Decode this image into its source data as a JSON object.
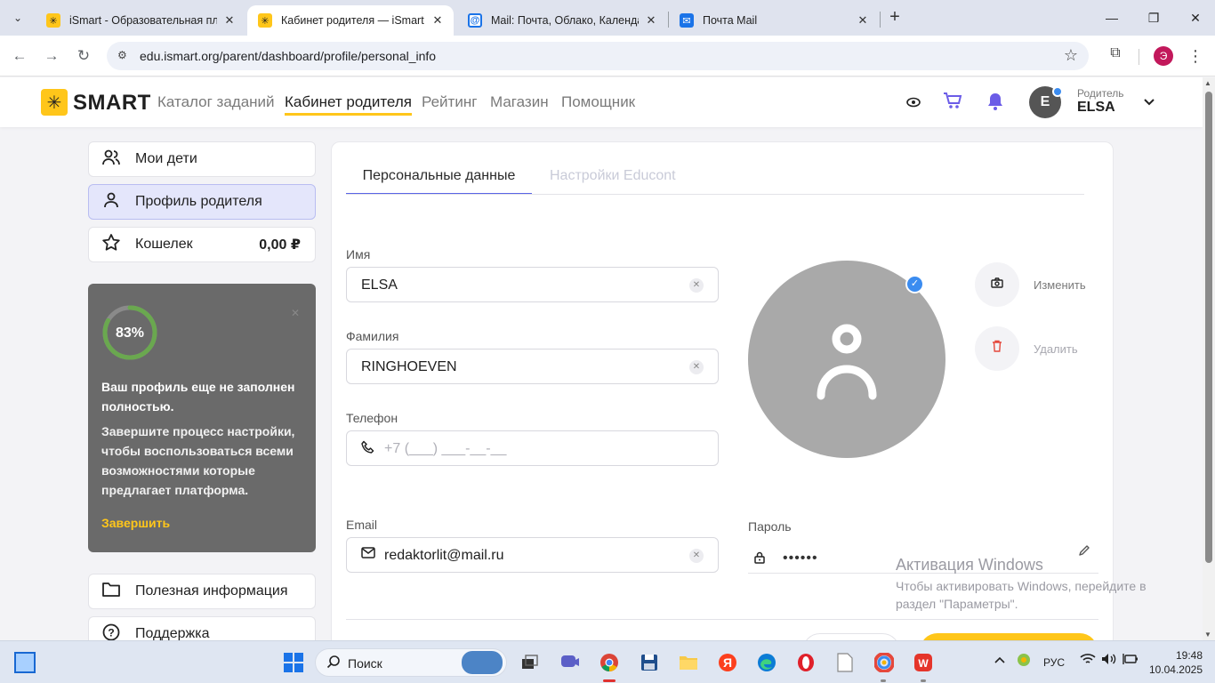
{
  "browser": {
    "tabs": [
      {
        "title": "iSmart - Образовательная пла",
        "favicon": "ismart-favicon",
        "active": false
      },
      {
        "title": "Кабинет родителя — iSmart",
        "favicon": "ismart-favicon",
        "active": true
      },
      {
        "title": "Mail: Почта, Облако, Календар",
        "favicon": "mail-at-favicon",
        "active": false
      },
      {
        "title": "Почта Mail",
        "favicon": "mail-envelope-favicon",
        "active": false
      }
    ],
    "url": "edu.ismart.org/parent/dashboard/profile/personal_info",
    "profile_initial": "Э"
  },
  "site_header": {
    "logo_text": "SMART",
    "nav": [
      "Каталог заданий",
      "Кабинет родителя",
      "Рейтинг",
      "Магазин",
      "Помощник"
    ],
    "active_nav": "Кабинет родителя",
    "user": {
      "initial": "E",
      "role": "Родитель",
      "name": "ELSA"
    }
  },
  "sidebar": {
    "items": [
      {
        "label": "Мои дети",
        "icon": "users-icon"
      },
      {
        "label": "Профиль родителя",
        "icon": "user-icon",
        "active": true
      },
      {
        "label": "Кошелек",
        "icon": "star-icon",
        "value": "0,00 ₽"
      }
    ],
    "promo": {
      "percent": "83%",
      "percent_value": 83,
      "title": "Ваш профиль еще не заполнен полностью.",
      "text": "Завершите процесс настройки, чтобы воспользоваться всеми возможностями которые предлагает платформа.",
      "link": "Завершить"
    },
    "bottom_items": [
      {
        "label": "Полезная информация",
        "icon": "folder-icon"
      },
      {
        "label": "Поддержка",
        "icon": "help-icon"
      }
    ]
  },
  "profile": {
    "tabs": [
      "Персональные данные",
      "Настройки Educont"
    ],
    "first_name": {
      "label": "Имя",
      "value": "ELSA"
    },
    "last_name": {
      "label": "Фамилия",
      "value": "RINGHOEVEN"
    },
    "phone": {
      "label": "Телефон",
      "placeholder": "+7 (___) ___-__-__"
    },
    "email": {
      "label": "Email",
      "value": "redaktorlit@mail.ru"
    },
    "password": {
      "label": "Пароль",
      "value": "••••••"
    },
    "photo_actions": {
      "change": "Изменить",
      "delete": "Удалить"
    }
  },
  "watermark": {
    "title": "Активация Windows",
    "text": "Чтобы активировать Windows, перейдите в раздел \"Параметры\"."
  },
  "taskbar": {
    "search_label": "Поиск",
    "language": "РУС",
    "time": "19:48",
    "date": "10.04.2025"
  },
  "colors": {
    "accent": "#ffc61a",
    "tab_underline": "#5965e6",
    "verified_badge": "#3b8cf0",
    "progress_ring": "#6aa84f"
  }
}
